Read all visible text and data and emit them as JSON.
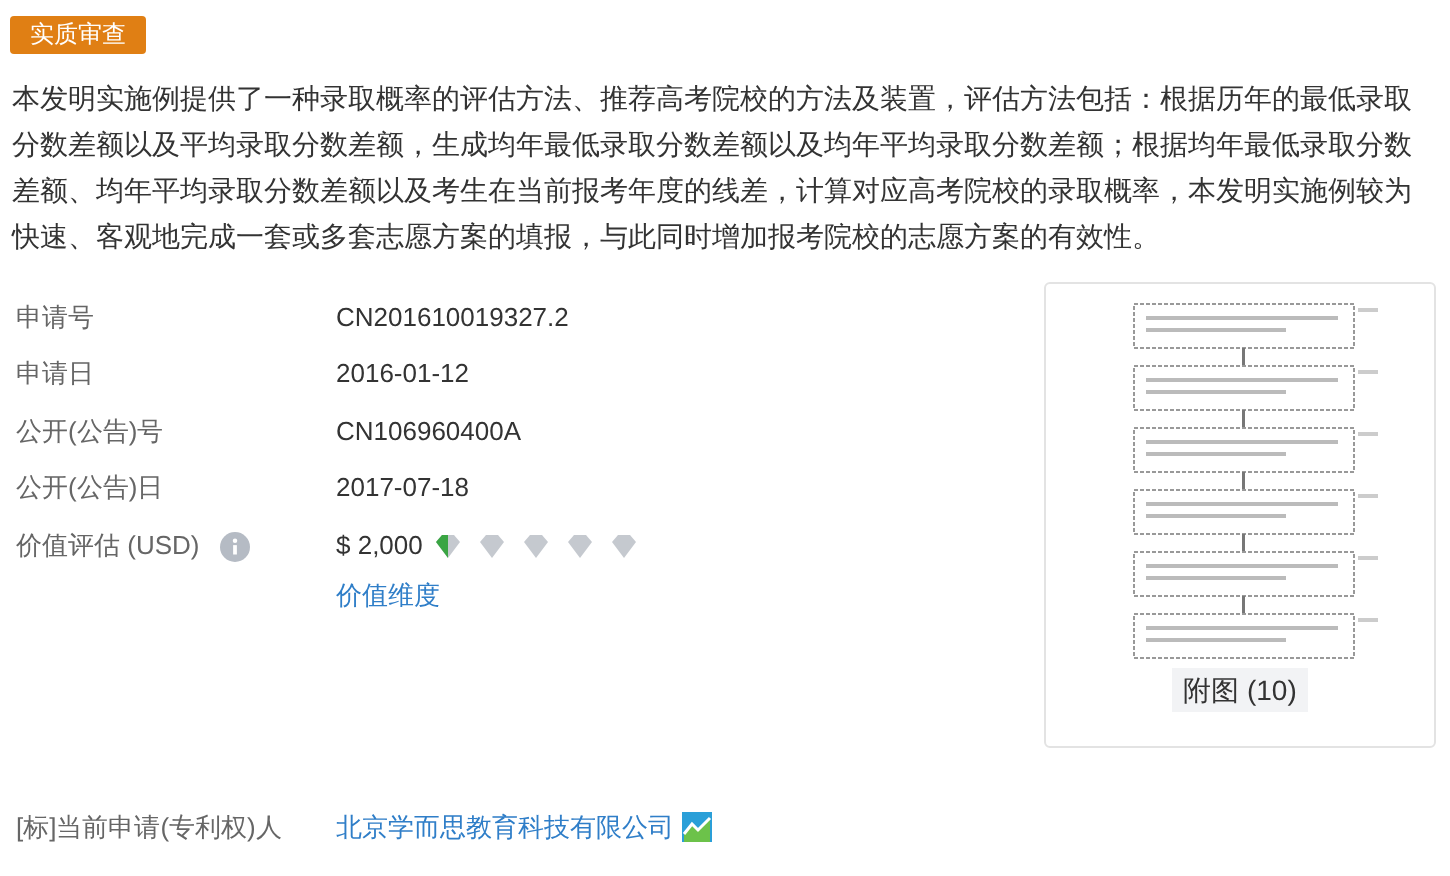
{
  "status_badge": "实质审查",
  "abstract": "本发明实施例提供了一种录取概率的评估方法、推荐高考院校的方法及装置，评估方法包括：根据历年的最低录取分数差额以及平均录取分数差额，生成均年最低录取分数差额以及均年平均录取分数差额；根据均年最低录取分数差额、均年平均录取分数差额以及考生在当前报考年度的线差，计算对应高考院校的录取概率，本发明实施例较为快速、客观地完成一套或多套志愿方案的填报，与此同时增加报考院校的志愿方案的有效性。",
  "fields": [
    {
      "label": "申请号",
      "value": "CN201610019327.2"
    },
    {
      "label": "申请日",
      "value": "2016-01-12"
    },
    {
      "label": "公开(公告)号",
      "value": "CN106960400A"
    },
    {
      "label": "公开(公告)日",
      "value": "2017-07-18"
    }
  ],
  "valuation": {
    "label": "价值评估 (USD)",
    "value": "$ 2,000",
    "stars": 0.5,
    "link": "价值维度"
  },
  "figure": {
    "caption": "附图 (10)"
  },
  "applicant": {
    "label": "[标]当前申请(专利权)人",
    "value": "北京学而思教育科技有限公司"
  }
}
